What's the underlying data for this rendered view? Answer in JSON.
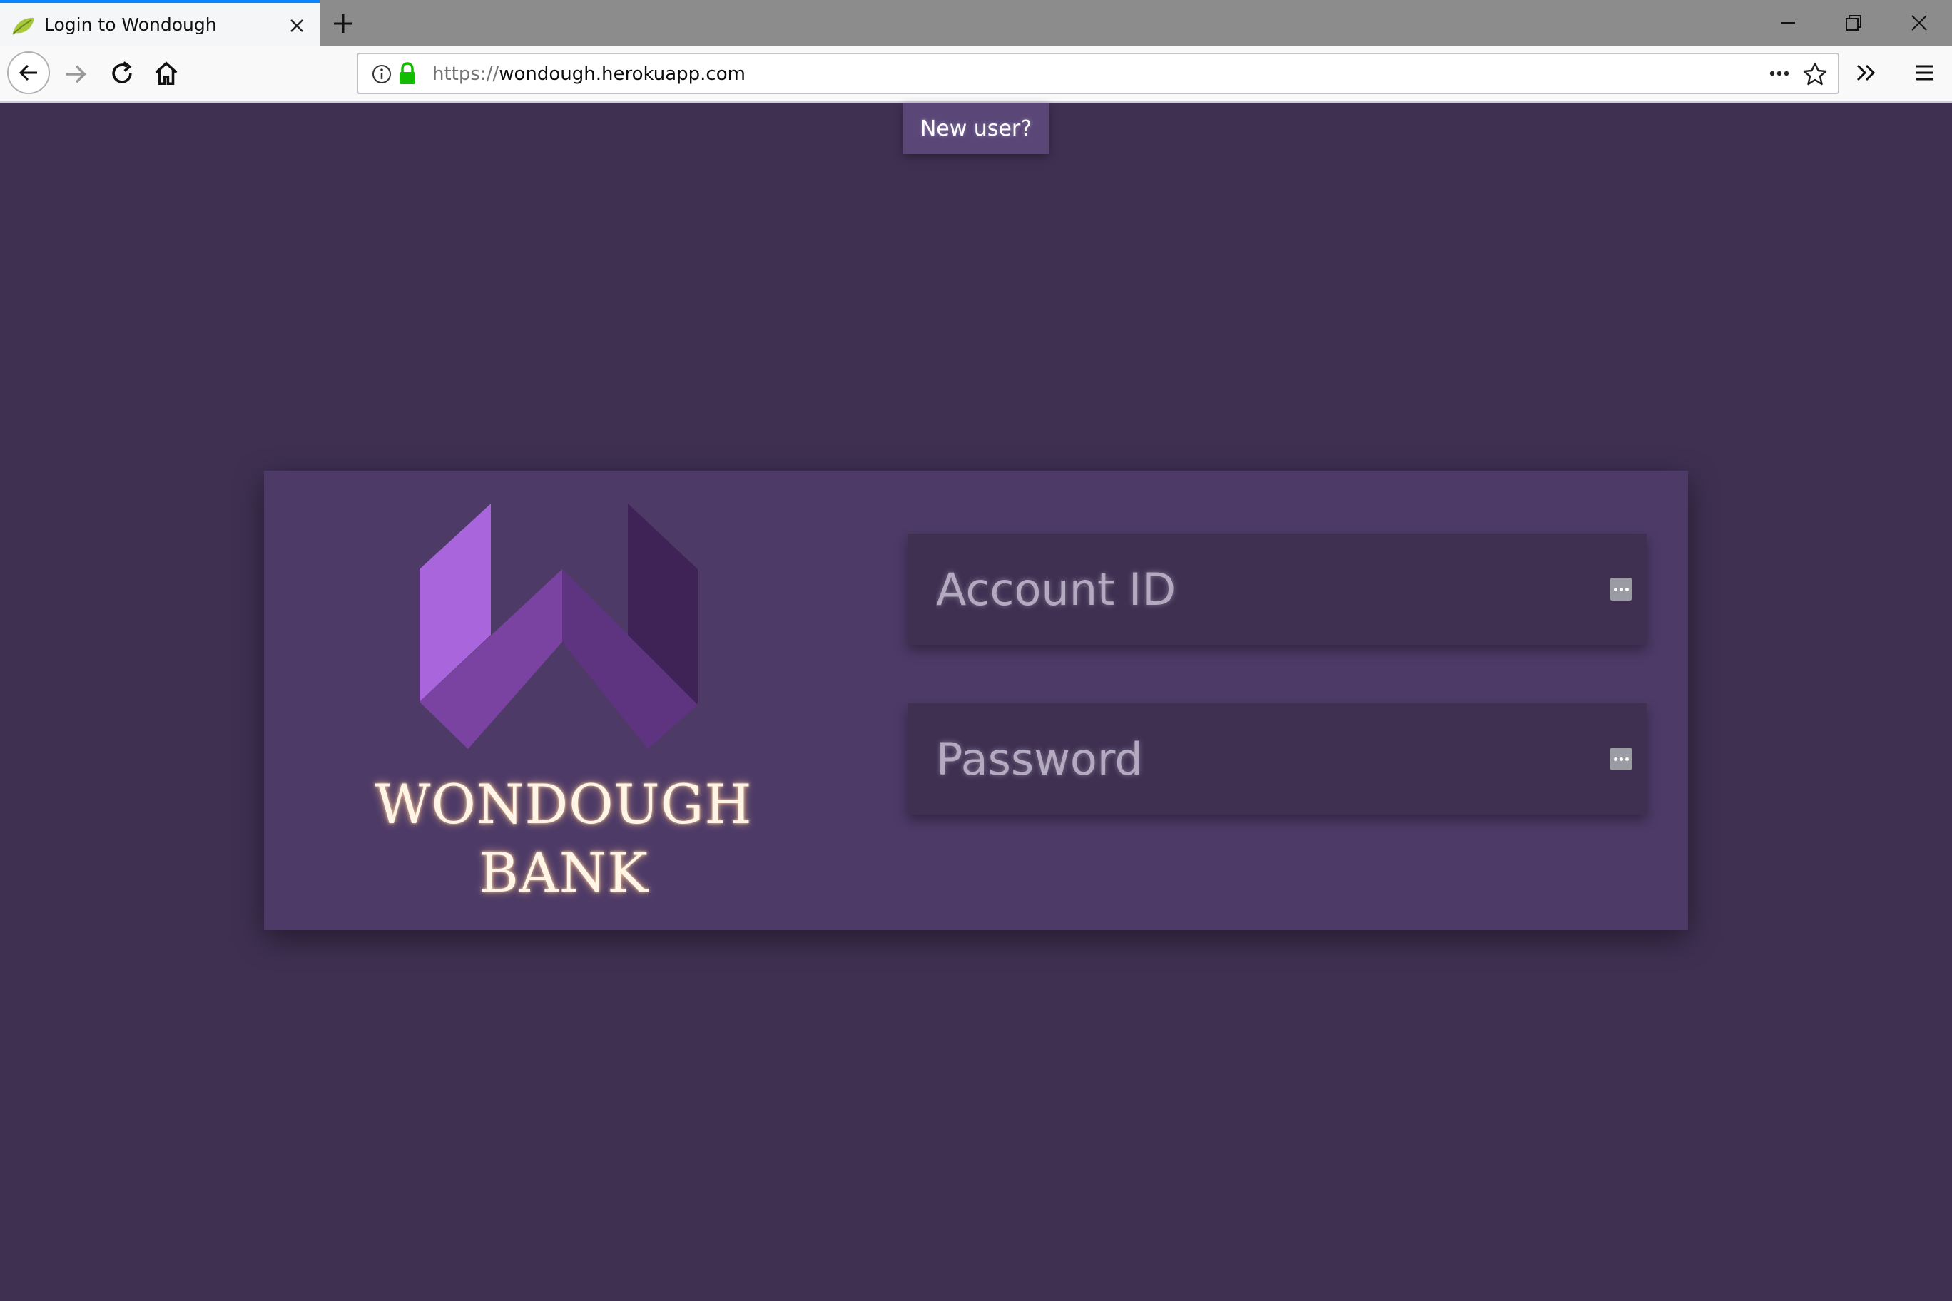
{
  "browser": {
    "tab_title": "Login to Wondough",
    "url_protocol": "https://",
    "url_host": "wondough.herokuapp.com",
    "icons": {
      "favicon": "leaf-icon",
      "tab_close": "close-icon",
      "new_tab": "plus-icon",
      "back": "back-arrow-icon",
      "forward": "forward-arrow-icon",
      "reload": "reload-icon",
      "home": "home-icon",
      "site_info": "info-icon",
      "secure": "lock-icon",
      "page_actions": "more-icon",
      "bookmark": "star-icon",
      "overflow": "double-chevron-icon",
      "menu": "hamburger-icon",
      "minimize": "minimize-icon",
      "maximize": "restore-icon",
      "close_window": "close-icon"
    },
    "colors": {
      "active_tab_accent": "#0a84ff",
      "lock": "#12bc00"
    }
  },
  "page": {
    "new_user_label": "New user?",
    "brand_line1": "WONDOUGH",
    "brand_line2": "BANK",
    "account_placeholder": "Account ID",
    "password_placeholder": "Password",
    "colors": {
      "background": "#3f3052",
      "card": "#4d3a67",
      "logo_light": "#a865dc",
      "logo_mid": "#7a42a1",
      "logo_dark": "#5e3380",
      "logo_darkest": "#3f2356"
    }
  }
}
